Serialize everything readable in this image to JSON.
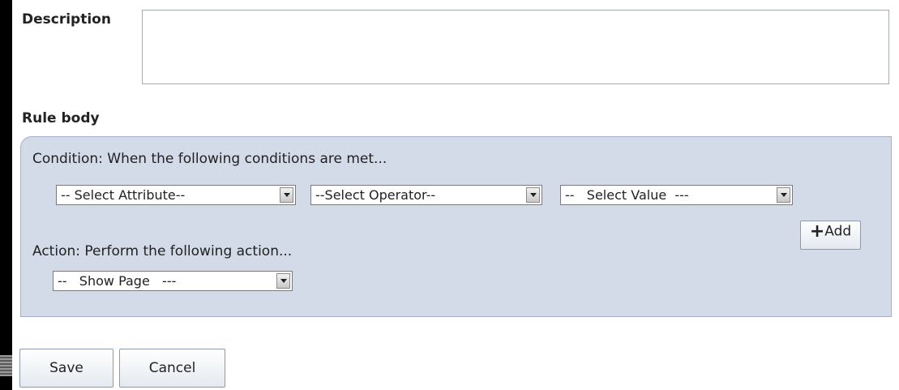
{
  "description": {
    "label": "Description",
    "value": ""
  },
  "rule_body": {
    "label": "Rule body",
    "condition_text": "Condition: When the following conditions are met...",
    "attribute_select": "-- Select Attribute-- ",
    "operator_select": "--Select Operator-- ",
    "value_select": "--   Select Value  --- ",
    "add_button": {
      "icon": "plus-icon",
      "label": "Add"
    },
    "action_text": "Action: Perform the following action...",
    "action_select": "--   Show Page   --- "
  },
  "footer": {
    "save_label": "Save",
    "cancel_label": "Cancel"
  }
}
